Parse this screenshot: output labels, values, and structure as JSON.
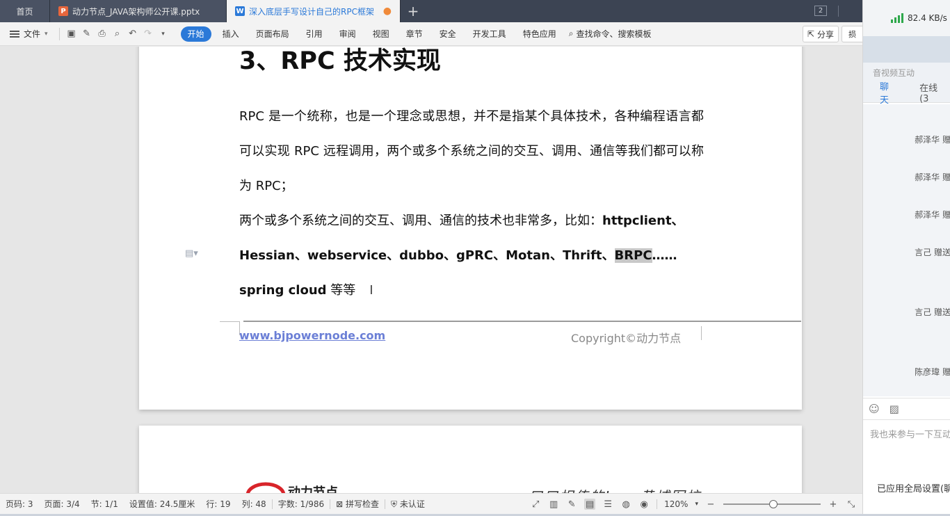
{
  "tabs": {
    "home": "首页",
    "pptx": "动力节点_JAVA架构师公开课.pptx",
    "doc": "深入底层手写设计自己的RPC框架",
    "count": "2"
  },
  "ribbon": {
    "file": "文件",
    "items": [
      "开始",
      "插入",
      "页面布局",
      "引用",
      "审阅",
      "视图",
      "章节",
      "安全",
      "开发工具",
      "特色应用"
    ],
    "search": "查找命令、搜索模板",
    "share": "分享",
    "extra": "损"
  },
  "doc": {
    "heading": "3、RPC 技术实现",
    "para1": "RPC 是一个统称，也是一个理念或思想，并不是指某个具体技术，各种编程语言都可以实现 RPC 远程调用，两个或多个系统之间的交互、调用、通信等我们都可以称为 RPC；",
    "para2_prefix": "两个或多个系统之间的交互、调用、通信的技术也非常多，比如：",
    "para2_bold1": "httpclient、Hessian、webservice、dubbo、gPRC、Motan、Thrift、",
    "para2_highlight": "BRPC",
    "para2_bold2": "……spring cloud",
    "para2_suffix": " 等等",
    "caret": "I",
    "footer_url": "www.bjpowernode.com",
    "footer_copy": "Copyright©动力节点",
    "page2_logo_text": "动力节点",
    "page2_hand": "口口相传的Java黄埔军校"
  },
  "status": {
    "items": [
      "页码: 3",
      "页面: 3/4",
      "节: 1/1",
      "设置值: 24.5厘米",
      "行: 19",
      "列: 48",
      "字数: 1/986",
      "拼写检查",
      "未认证"
    ],
    "zoom": "120%"
  },
  "panel": {
    "speed": "82.4 KB/s",
    "av": "音视频互动",
    "tab_chat": "聊天",
    "tab_online": "在线(3",
    "msgs": [
      "郝泽华 赠",
      "郝泽华 赠",
      "郝泽华 赠",
      "言己 赠送",
      "言己 赠送",
      "陈彦瑋 赠"
    ],
    "placeholder": "我也来参与一下互动",
    "setting": "已应用全局设置(聊"
  }
}
